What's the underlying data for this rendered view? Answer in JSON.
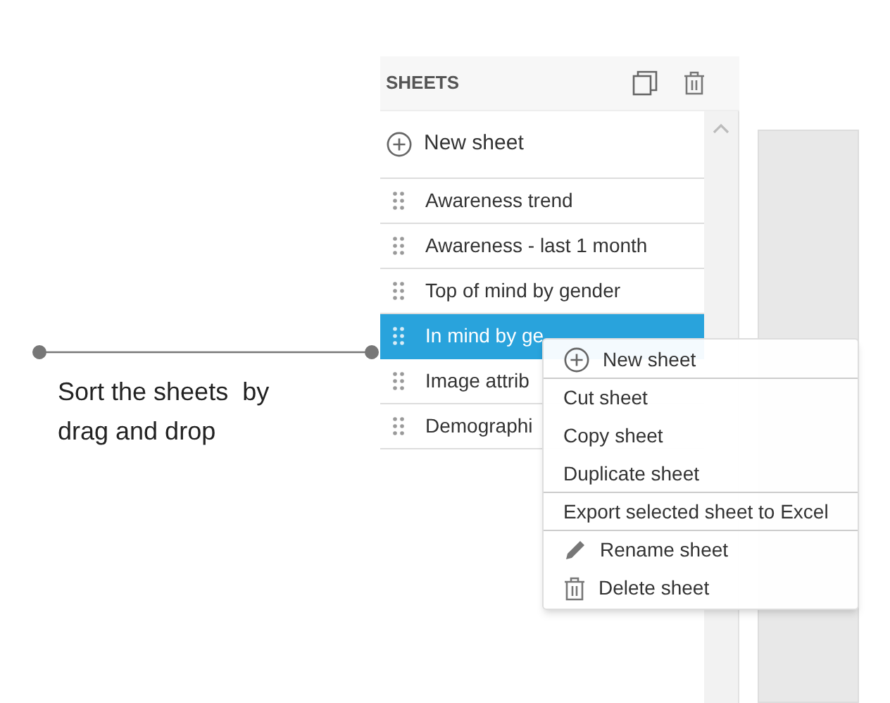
{
  "annotation": {
    "text": "Sort the sheets  by drag and drop"
  },
  "sheets_panel": {
    "title": "SHEETS",
    "new_sheet": "New sheet",
    "items": [
      {
        "label": "Awareness trend",
        "selected": false
      },
      {
        "label": "Awareness - last 1 month",
        "selected": false
      },
      {
        "label": "Top of mind by gender",
        "selected": false
      },
      {
        "label": "In mind by ge",
        "selected": true
      },
      {
        "label": "Image attrib",
        "selected": false
      },
      {
        "label": "Demographi",
        "selected": false
      }
    ]
  },
  "context_menu": {
    "items": [
      {
        "label": "New sheet",
        "kind": "add",
        "separator_below": true
      },
      {
        "label": "Cut sheet",
        "kind": "plain",
        "separator_below": false
      },
      {
        "label": "Copy sheet",
        "kind": "plain",
        "separator_below": false
      },
      {
        "label": "Duplicate sheet",
        "kind": "plain",
        "separator_below": true
      },
      {
        "label": "Export selected sheet to Excel",
        "kind": "plain",
        "separator_below": true
      },
      {
        "label": "Rename sheet",
        "kind": "rename",
        "separator_below": false
      },
      {
        "label": "Delete sheet",
        "kind": "delete",
        "separator_below": false
      }
    ]
  }
}
